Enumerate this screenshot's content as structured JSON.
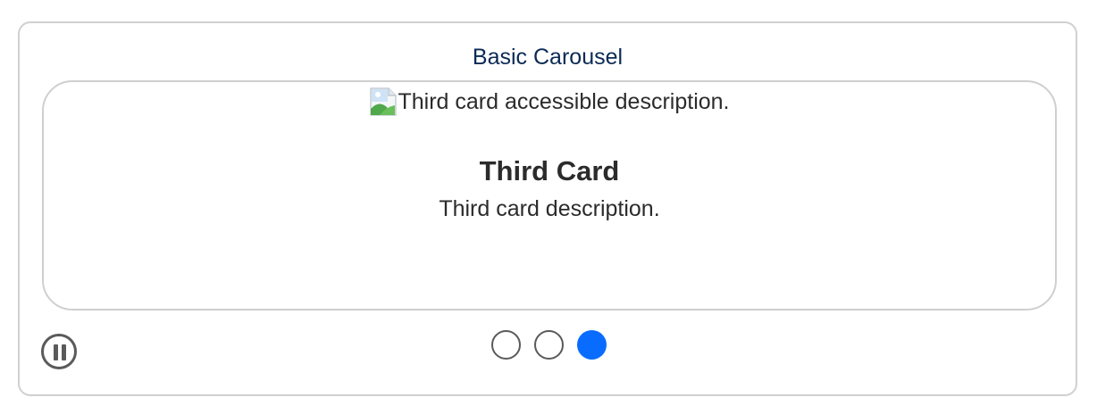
{
  "carousel": {
    "title": "Basic Carousel",
    "card": {
      "image_alt": "Third card accessible description.",
      "title": "Third Card",
      "description": "Third card description."
    },
    "pause_icon": "pause-icon",
    "indicators": [
      {
        "label": "1",
        "active": false
      },
      {
        "label": "2",
        "active": false
      },
      {
        "label": "3",
        "active": true
      }
    ],
    "colors": {
      "title": "#0b2a55",
      "active_indicator": "#0a6cff",
      "border": "#d0d0d0",
      "text": "#2b2b2b"
    }
  }
}
